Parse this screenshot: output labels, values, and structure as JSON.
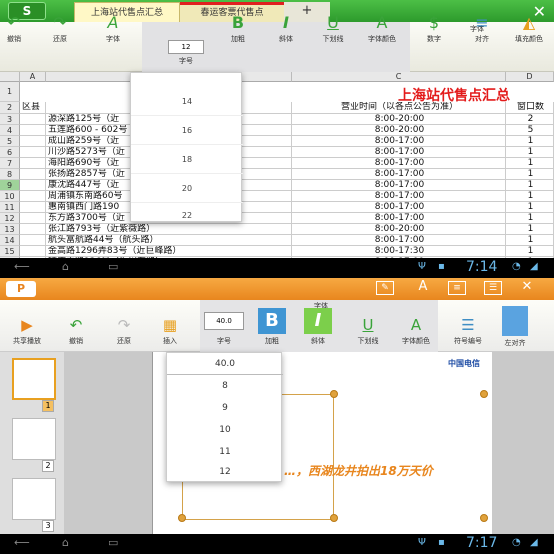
{
  "top": {
    "app_icon": "S",
    "tabs": [
      "上海站代售点汇总",
      "春运客票代售点",
      "+"
    ],
    "close": "✕",
    "toolbar": {
      "undo": "撤销",
      "redo": "还原",
      "font": "字体",
      "size": "字号",
      "bold": "加粗",
      "italic": "斜体",
      "underline": "下划线",
      "font_color": "字体颜色",
      "group_title": "字体",
      "number": "数字",
      "align": "对齐",
      "fill": "填充颜色"
    },
    "size_value": "12",
    "size_options": [
      "14",
      "16",
      "18",
      "20",
      "22"
    ],
    "columns": [
      "A",
      "B",
      "C",
      "D"
    ],
    "sheet_title": "上海站代售点汇总",
    "header_row": {
      "a": "区县",
      "c": "营业时间（以各点公告为准）",
      "d": "窗口数"
    },
    "rows": [
      {
        "n": "1",
        "b": "",
        "c": "",
        "d": ""
      },
      {
        "n": "2",
        "b": "",
        "c": "",
        "d": ""
      },
      {
        "n": "3",
        "b": "源深路125号（近",
        "c": "8:00-20:00",
        "d": "2"
      },
      {
        "n": "4",
        "b": "五莲路600 - 602号",
        "c": "8:00-20:00",
        "d": "5"
      },
      {
        "n": "5",
        "b": "成山路259号（近",
        "c": "8:00-17:00",
        "d": "1"
      },
      {
        "n": "6",
        "b": "川沙路5273号（近",
        "c": "8:00-17:00",
        "d": "1"
      },
      {
        "n": "7",
        "b": "海阳路690号（近",
        "c": "8:00-17:00",
        "d": "1"
      },
      {
        "n": "8",
        "b": "张扬路2857号（近",
        "c": "8:00-17:00",
        "d": "1"
      },
      {
        "n": "9",
        "b": "康沈路447号（近",
        "c": "8:00-17:00",
        "d": "1"
      },
      {
        "n": "10",
        "b": "周浦镇东南路60号",
        "c": "8:00-17:00",
        "d": "1"
      },
      {
        "n": "11",
        "b": "惠南镇西门路190",
        "c": "8:00-17:00",
        "d": "1"
      },
      {
        "n": "12",
        "b": "东方路3700号（近",
        "c": "8:00-17:00",
        "d": "1"
      },
      {
        "n": "13",
        "b": "张江路793号（近紫薇路）",
        "c": "8:00-20:00",
        "d": "1"
      },
      {
        "n": "14",
        "b": "航头富航路44号（航头路）",
        "c": "8:00-17:00",
        "d": "1"
      },
      {
        "n": "15",
        "b": "金高路1296弄83号（近巨峰路）",
        "c": "8:00-17:30",
        "d": "1"
      },
      {
        "n": "16",
        "b": "环庆中路126号（近川东路）",
        "c": "8:00-17:00",
        "d": "1"
      }
    ]
  },
  "status": {
    "clock_top": "7:14",
    "clock_bottom": "7:17"
  },
  "bottom": {
    "app_icon": "P",
    "toolbar": {
      "share": "共享播放",
      "undo": "撤销",
      "redo": "还原",
      "insert": "插入",
      "size": "字号",
      "bold": "加粗",
      "italic": "斜体",
      "underline": "下划线",
      "font_color": "字体颜色",
      "group_title": "字体",
      "bullets": "符号编号",
      "align_left": "左对齐"
    },
    "size_value": "40.0",
    "size_options": [
      "40.0",
      "8",
      "9",
      "10",
      "11",
      "12"
    ],
    "thumb_numbers": [
      "1",
      "2",
      "3"
    ],
    "slide_text": "…，西湖龙井拍出18万天价",
    "logo_text": "中国电信"
  },
  "colors": {
    "excel_green": "#2d9a2c",
    "office_orange": "#e8861e",
    "title_red": "#e31b1b"
  }
}
